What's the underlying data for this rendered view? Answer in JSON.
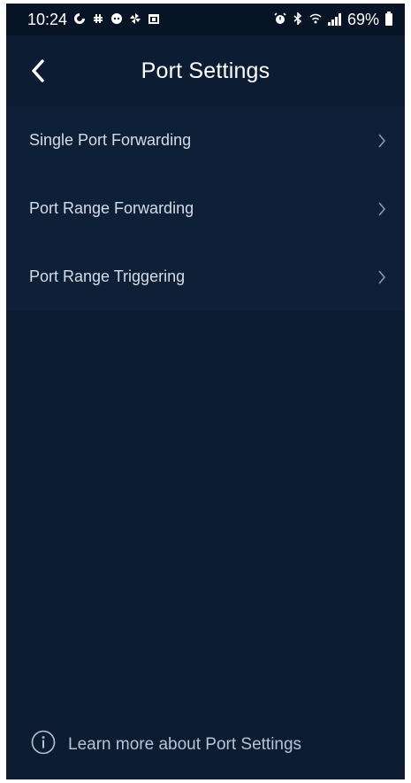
{
  "status_bar": {
    "time": "10:24",
    "battery": "69%",
    "left_icons": [
      "sync-icon",
      "slack-icon",
      "discord-icon",
      "pinwheel-icon",
      "calendar-icon"
    ],
    "right_icons": [
      "alarm-icon",
      "bluetooth-icon",
      "wifi-calling-icon",
      "signal-icon",
      "battery-icon"
    ]
  },
  "header": {
    "title": "Port Settings",
    "back_icon": "chevron-left-icon"
  },
  "menu": {
    "items": [
      {
        "label": "Single Port Forwarding"
      },
      {
        "label": "Port Range Forwarding"
      },
      {
        "label": "Port Range Triggering"
      }
    ]
  },
  "footer": {
    "link_text": "Learn more about Port Settings",
    "icon": "info-icon"
  },
  "colors": {
    "background": "#0b1c33",
    "status_bar": "#071426",
    "list_background": "#0e2038",
    "text_primary": "#ffffff",
    "text_secondary": "#d5dce6"
  }
}
